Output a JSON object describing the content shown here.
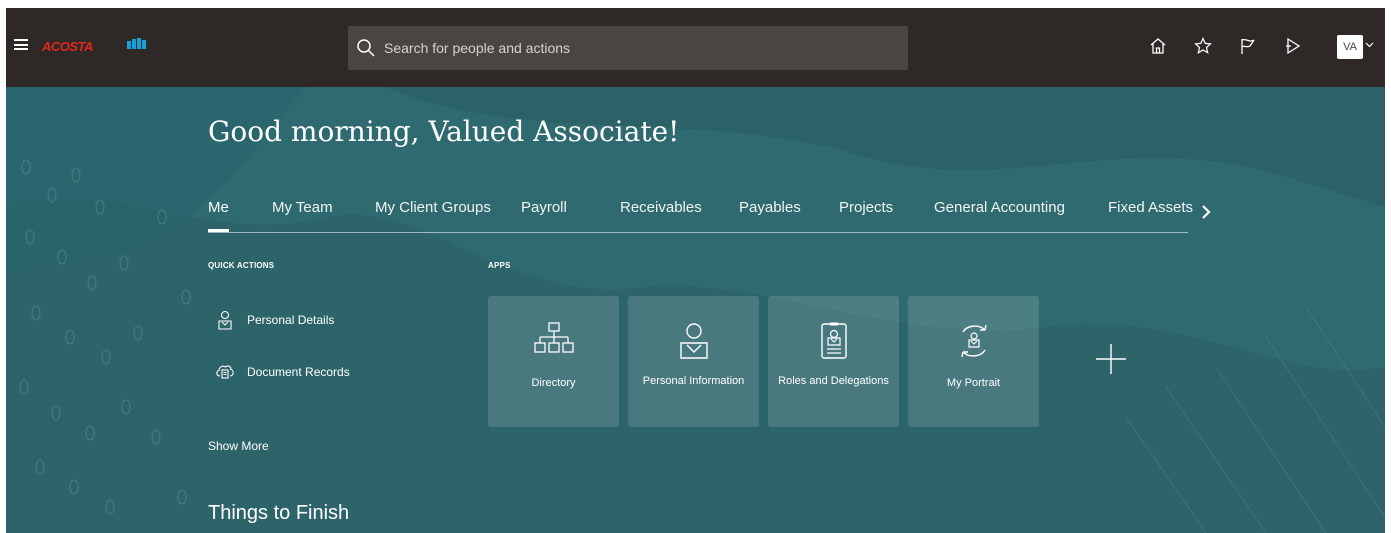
{
  "brand": {
    "name": "ACOSTA",
    "accent": "#e3261c"
  },
  "colors": {
    "topbar": "#2e2926",
    "hero": "#2f6a70",
    "search_bg": "#4a4541"
  },
  "search": {
    "placeholder": "Search for people and actions",
    "icon": "search-icon"
  },
  "toolbar": {
    "icons": [
      "home-icon",
      "star-icon",
      "flag-icon",
      "notifications-icon"
    ],
    "avatar_initials": "VA"
  },
  "hero": {
    "greeting": "Good morning, Valued Associate!",
    "tabs": [
      "Me",
      "My Team",
      "My Client Groups",
      "Payroll",
      "Receivables",
      "Payables",
      "Projects",
      "General Accounting",
      "Fixed Assets"
    ],
    "active_tab": "Me"
  },
  "quick_actions": {
    "title": "QUICK ACTIONS",
    "items": [
      {
        "label": "Personal Details",
        "icon": "person-icon"
      },
      {
        "label": "Document Records",
        "icon": "document-cloud-icon"
      }
    ],
    "show_more": "Show More"
  },
  "apps": {
    "title": "APPS",
    "tiles": [
      {
        "label": "Directory",
        "icon": "org-chart-icon"
      },
      {
        "label": "Personal Information",
        "icon": "person-icon"
      },
      {
        "label": "Roles and Delegations",
        "icon": "badge-icon"
      },
      {
        "label": "My Portrait",
        "icon": "portrait-icon"
      }
    ]
  },
  "things_to_finish": {
    "title": "Things to Finish"
  }
}
